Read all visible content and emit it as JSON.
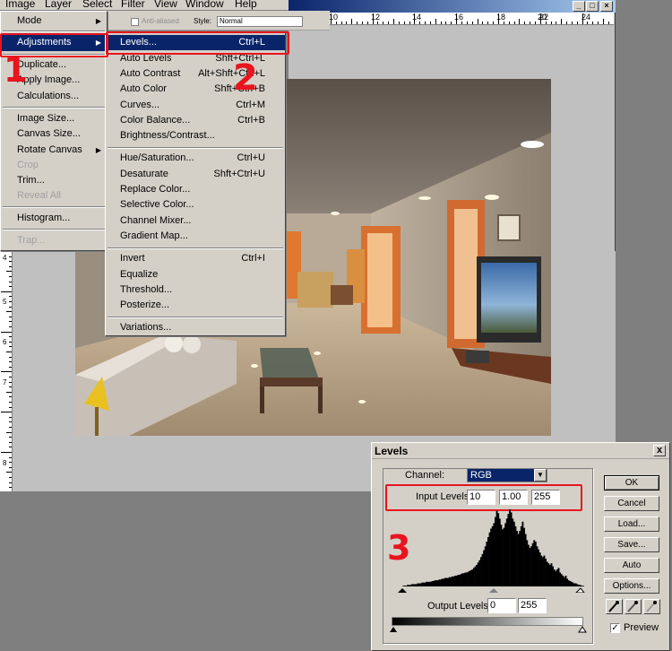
{
  "menubar": {
    "items": [
      "Image",
      "Layer",
      "Select",
      "Filter",
      "View",
      "Window",
      "Help"
    ]
  },
  "options_bar": {
    "anti_aliased_label": "Anti-aliased",
    "style_label": "Style:",
    "style_value": "Normal"
  },
  "ruler": {
    "h_ticks": [
      "10",
      "12",
      "14",
      "16",
      "18",
      "20",
      "22",
      "24"
    ],
    "v_ticks": [
      "4",
      "5",
      "6",
      "7",
      "8"
    ]
  },
  "image_menu": {
    "items": [
      {
        "label": "Mode",
        "submenu": true
      },
      {
        "label": "Adjustments",
        "submenu": true,
        "highlighted": true
      },
      {
        "label": "Duplicate..."
      },
      {
        "label": "Apply Image..."
      },
      {
        "label": "Calculations..."
      },
      {
        "label": "Image Size..."
      },
      {
        "label": "Canvas Size..."
      },
      {
        "label": "Rotate Canvas",
        "submenu": true
      },
      {
        "label": "Crop",
        "disabled": true
      },
      {
        "label": "Trim..."
      },
      {
        "label": "Reveal All",
        "disabled": true
      },
      {
        "label": "Histogram..."
      },
      {
        "label": "Trap...",
        "disabled": true
      }
    ]
  },
  "adjustments_menu": {
    "items": [
      {
        "label": "Levels...",
        "shortcut": "Ctrl+L",
        "highlighted": true
      },
      {
        "label": "Auto Levels",
        "shortcut": "Shft+Ctrl+L"
      },
      {
        "label": "Auto Contrast",
        "shortcut": "Alt+Shft+Ctrl+L"
      },
      {
        "label": "Auto Color",
        "shortcut": "Shft+Ctrl+B"
      },
      {
        "label": "Curves...",
        "shortcut": "Ctrl+M"
      },
      {
        "label": "Color Balance...",
        "shortcut": "Ctrl+B"
      },
      {
        "label": "Brightness/Contrast...",
        "shortcut": ""
      },
      {
        "label": "Hue/Saturation...",
        "shortcut": "Ctrl+U"
      },
      {
        "label": "Desaturate",
        "shortcut": "Shft+Ctrl+U"
      },
      {
        "label": "Replace Color...",
        "shortcut": ""
      },
      {
        "label": "Selective Color...",
        "shortcut": ""
      },
      {
        "label": "Channel Mixer...",
        "shortcut": ""
      },
      {
        "label": "Gradient Map...",
        "shortcut": ""
      },
      {
        "label": "Invert",
        "shortcut": "Ctrl+I"
      },
      {
        "label": "Equalize",
        "shortcut": ""
      },
      {
        "label": "Threshold...",
        "shortcut": ""
      },
      {
        "label": "Posterize...",
        "shortcut": ""
      },
      {
        "label": "Variations...",
        "shortcut": ""
      }
    ]
  },
  "annotations": {
    "step1": "1",
    "step2": "2",
    "step3": "3",
    "color": "#e8141e"
  },
  "levels_dialog": {
    "title": "Levels",
    "close_glyph": "x",
    "channel_label": "Channel:",
    "channel_value": "RGB",
    "input_levels_label": "Input Levels:",
    "input_black": "10",
    "input_gamma": "1.00",
    "input_white": "255",
    "output_levels_label": "Output Levels:",
    "output_black": "0",
    "output_white": "255",
    "buttons": {
      "ok": "OK",
      "cancel": "Cancel",
      "load": "Load...",
      "save": "Save...",
      "auto": "Auto",
      "options": "Options..."
    },
    "preview_label": "Preview",
    "preview_checked": true,
    "eyedropper_icons": [
      "black-eyedropper-icon",
      "gray-eyedropper-icon",
      "white-eyedropper-icon"
    ],
    "histogram": [
      0,
      0,
      0,
      0,
      1,
      1,
      1,
      2,
      2,
      2,
      3,
      3,
      3,
      3,
      4,
      4,
      4,
      5,
      5,
      5,
      6,
      6,
      6,
      6,
      7,
      7,
      8,
      8,
      8,
      9,
      9,
      10,
      10,
      11,
      11,
      11,
      12,
      12,
      13,
      13,
      14,
      14,
      15,
      15,
      16,
      17,
      17,
      18,
      18,
      19,
      20,
      21,
      22,
      24,
      26,
      28,
      31,
      34,
      38,
      42,
      47,
      52,
      58,
      64,
      70,
      75,
      78,
      82,
      90,
      98,
      95,
      88,
      80,
      74,
      76,
      82,
      88,
      94,
      100,
      96,
      88,
      84,
      78,
      72,
      68,
      72,
      78,
      84,
      76,
      68,
      60,
      54,
      50,
      52,
      56,
      60,
      58,
      52,
      48,
      44,
      40,
      38,
      40,
      36,
      32,
      30,
      28,
      30,
      26,
      22,
      20,
      22,
      24,
      18,
      16,
      14,
      12,
      14,
      10,
      8,
      7,
      6,
      5,
      4,
      4,
      3,
      2,
      2,
      1,
      1,
      0
    ]
  }
}
